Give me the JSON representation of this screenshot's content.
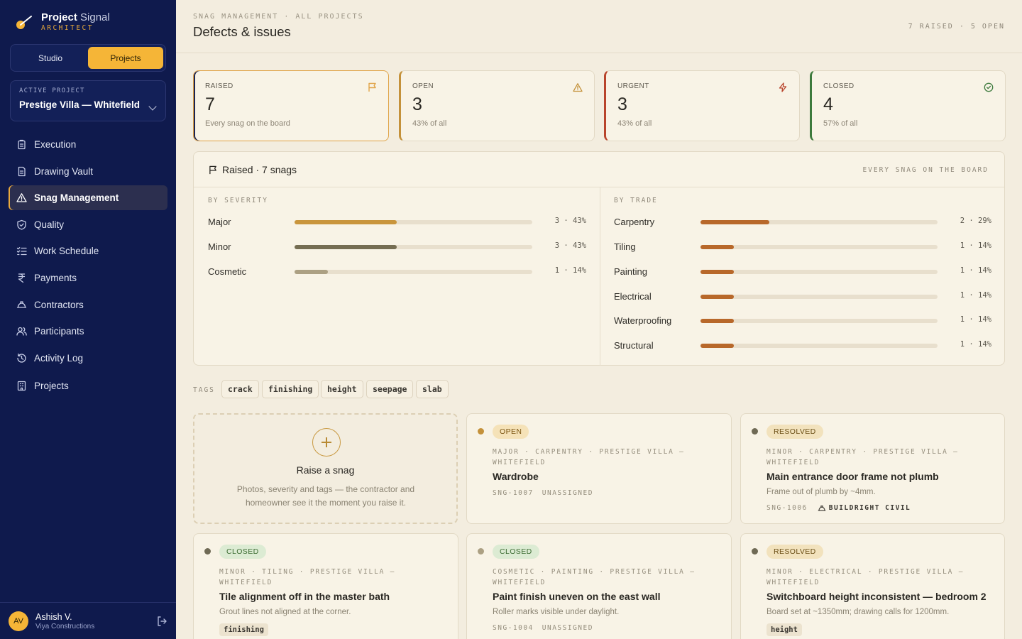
{
  "brand": {
    "title_bold": "Project",
    "title_light": "Signal",
    "subtitle": "ARCHITECT"
  },
  "switcher": {
    "studio": "Studio",
    "projects": "Projects"
  },
  "project": {
    "label": "ACTIVE PROJECT",
    "name": "Prestige Villa — Whitefield"
  },
  "nav": [
    {
      "label": "Execution",
      "icon": "clipboard-icon"
    },
    {
      "label": "Drawing Vault",
      "icon": "document-icon"
    },
    {
      "label": "Snag Management",
      "icon": "warning-icon",
      "active": true
    },
    {
      "label": "Quality",
      "icon": "shield-icon"
    },
    {
      "label": "Work Schedule",
      "icon": "checklist-icon"
    },
    {
      "label": "Payments",
      "icon": "rupee-icon"
    },
    {
      "label": "Contractors",
      "icon": "hard-hat-icon"
    },
    {
      "label": "Participants",
      "icon": "users-icon"
    },
    {
      "label": "Activity Log",
      "icon": "history-icon"
    },
    {
      "label": "Projects",
      "icon": "building-icon"
    }
  ],
  "user": {
    "initials": "AV",
    "name": "Ashish V.",
    "org": "Viya Constructions"
  },
  "header": {
    "breadcrumb": "SNAG MANAGEMENT · ALL PROJECTS",
    "title": "Defects & issues",
    "counts": "7 RAISED · 5 OPEN"
  },
  "stats": [
    {
      "label": "RAISED",
      "value": "7",
      "sub": "Every snag on the board",
      "icon": "flag-icon",
      "accent": "#e0a449"
    },
    {
      "label": "OPEN",
      "value": "3",
      "sub": "43% of all",
      "icon": "warning-icon",
      "accent": "#c4913a"
    },
    {
      "label": "URGENT",
      "value": "3",
      "sub": "43% of all",
      "icon": "bolt-icon",
      "accent": "#b8442c"
    },
    {
      "label": "CLOSED",
      "value": "4",
      "sub": "57% of all",
      "icon": "check-circle-icon",
      "accent": "#3d7a3d"
    }
  ],
  "breakdown": {
    "title": "Raised · 7 snags",
    "right_label": "EVERY SNAG ON THE BOARD",
    "severity_label": "BY SEVERITY",
    "trade_label": "BY TRADE",
    "severity": [
      {
        "name": "Major",
        "count": 3,
        "pct": 43,
        "value_text": "3 · 43%",
        "color": "#c9953c"
      },
      {
        "name": "Minor",
        "count": 3,
        "pct": 43,
        "value_text": "3 · 43%",
        "color": "#756d52"
      },
      {
        "name": "Cosmetic",
        "count": 1,
        "pct": 14,
        "value_text": "1 · 14%",
        "color": "#aca083"
      }
    ],
    "trade": [
      {
        "name": "Carpentry",
        "count": 2,
        "pct": 29,
        "value_text": "2 · 29%",
        "color": "#b8682a"
      },
      {
        "name": "Tiling",
        "count": 1,
        "pct": 14,
        "value_text": "1 · 14%",
        "color": "#b8682a"
      },
      {
        "name": "Painting",
        "count": 1,
        "pct": 14,
        "value_text": "1 · 14%",
        "color": "#b8682a"
      },
      {
        "name": "Electrical",
        "count": 1,
        "pct": 14,
        "value_text": "1 · 14%",
        "color": "#b8682a"
      },
      {
        "name": "Waterproofing",
        "count": 1,
        "pct": 14,
        "value_text": "1 · 14%",
        "color": "#b8682a"
      },
      {
        "name": "Structural",
        "count": 1,
        "pct": 14,
        "value_text": "1 · 14%",
        "color": "#b8682a"
      }
    ]
  },
  "tags": {
    "label": "TAGS",
    "items": [
      "crack",
      "finishing",
      "height",
      "seepage",
      "slab"
    ]
  },
  "new_snag": {
    "title": "Raise a snag",
    "desc": "Photos, severity and tags — the contractor and homeowner see it the moment you raise it."
  },
  "snags": [
    {
      "status": "OPEN",
      "dot": "#c4913a",
      "badge_bg": "#f5e2b8",
      "badge_fg": "#7a5410",
      "meta_line1": "MAJOR · CARPENTRY · PRESTIGE VILLA —",
      "meta_line2": "WHITEFIELD",
      "title": "Wardrobe",
      "desc": "",
      "id": "SNG-1007",
      "assignee": "UNASSIGNED",
      "assignee_bold": false,
      "tag": ""
    },
    {
      "status": "RESOLVED",
      "dot": "#6f6a55",
      "badge_bg": "#f2e2bd",
      "badge_fg": "#6b4f16",
      "meta_line1": "MINOR · CARPENTRY · PRESTIGE VILLA —",
      "meta_line2": "WHITEFIELD",
      "title": "Main entrance door frame not plumb",
      "desc": "Frame out of plumb by ~4mm.",
      "id": "SNG-1006",
      "assignee": "BUILDRIGHT CIVIL",
      "assignee_bold": true,
      "tag": ""
    },
    {
      "status": "CLOSED",
      "dot": "#6f6a55",
      "badge_bg": "#dcebd3",
      "badge_fg": "#3b6b31",
      "meta_line1": "MINOR · TILING · PRESTIGE VILLA —",
      "meta_line2": "WHITEFIELD",
      "title": "Tile alignment off in the master bath",
      "desc": "Grout lines not aligned at the corner.",
      "id": "",
      "assignee": "",
      "assignee_bold": false,
      "tag": "finishing"
    },
    {
      "status": "CLOSED",
      "dot": "#aca083",
      "badge_bg": "#dcebd3",
      "badge_fg": "#3b6b31",
      "meta_line1": "COSMETIC · PAINTING · PRESTIGE VILLA —",
      "meta_line2": "WHITEFIELD",
      "title": "Paint finish uneven on the east wall",
      "desc": "Roller marks visible under daylight.",
      "id": "SNG-1004",
      "assignee": "UNASSIGNED",
      "assignee_bold": false,
      "tag": ""
    },
    {
      "status": "RESOLVED",
      "dot": "#6f6a55",
      "badge_bg": "#f2e2bd",
      "badge_fg": "#6b4f16",
      "meta_line1": "MINOR · ELECTRICAL · PRESTIGE VILLA —",
      "meta_line2": "WHITEFIELD",
      "title": "Switchboard height inconsistent — bedroom 2",
      "desc": "Board set at ~1350mm; drawing calls for 1200mm.",
      "id": "",
      "assignee": "",
      "assignee_bold": false,
      "tag": "height"
    }
  ]
}
